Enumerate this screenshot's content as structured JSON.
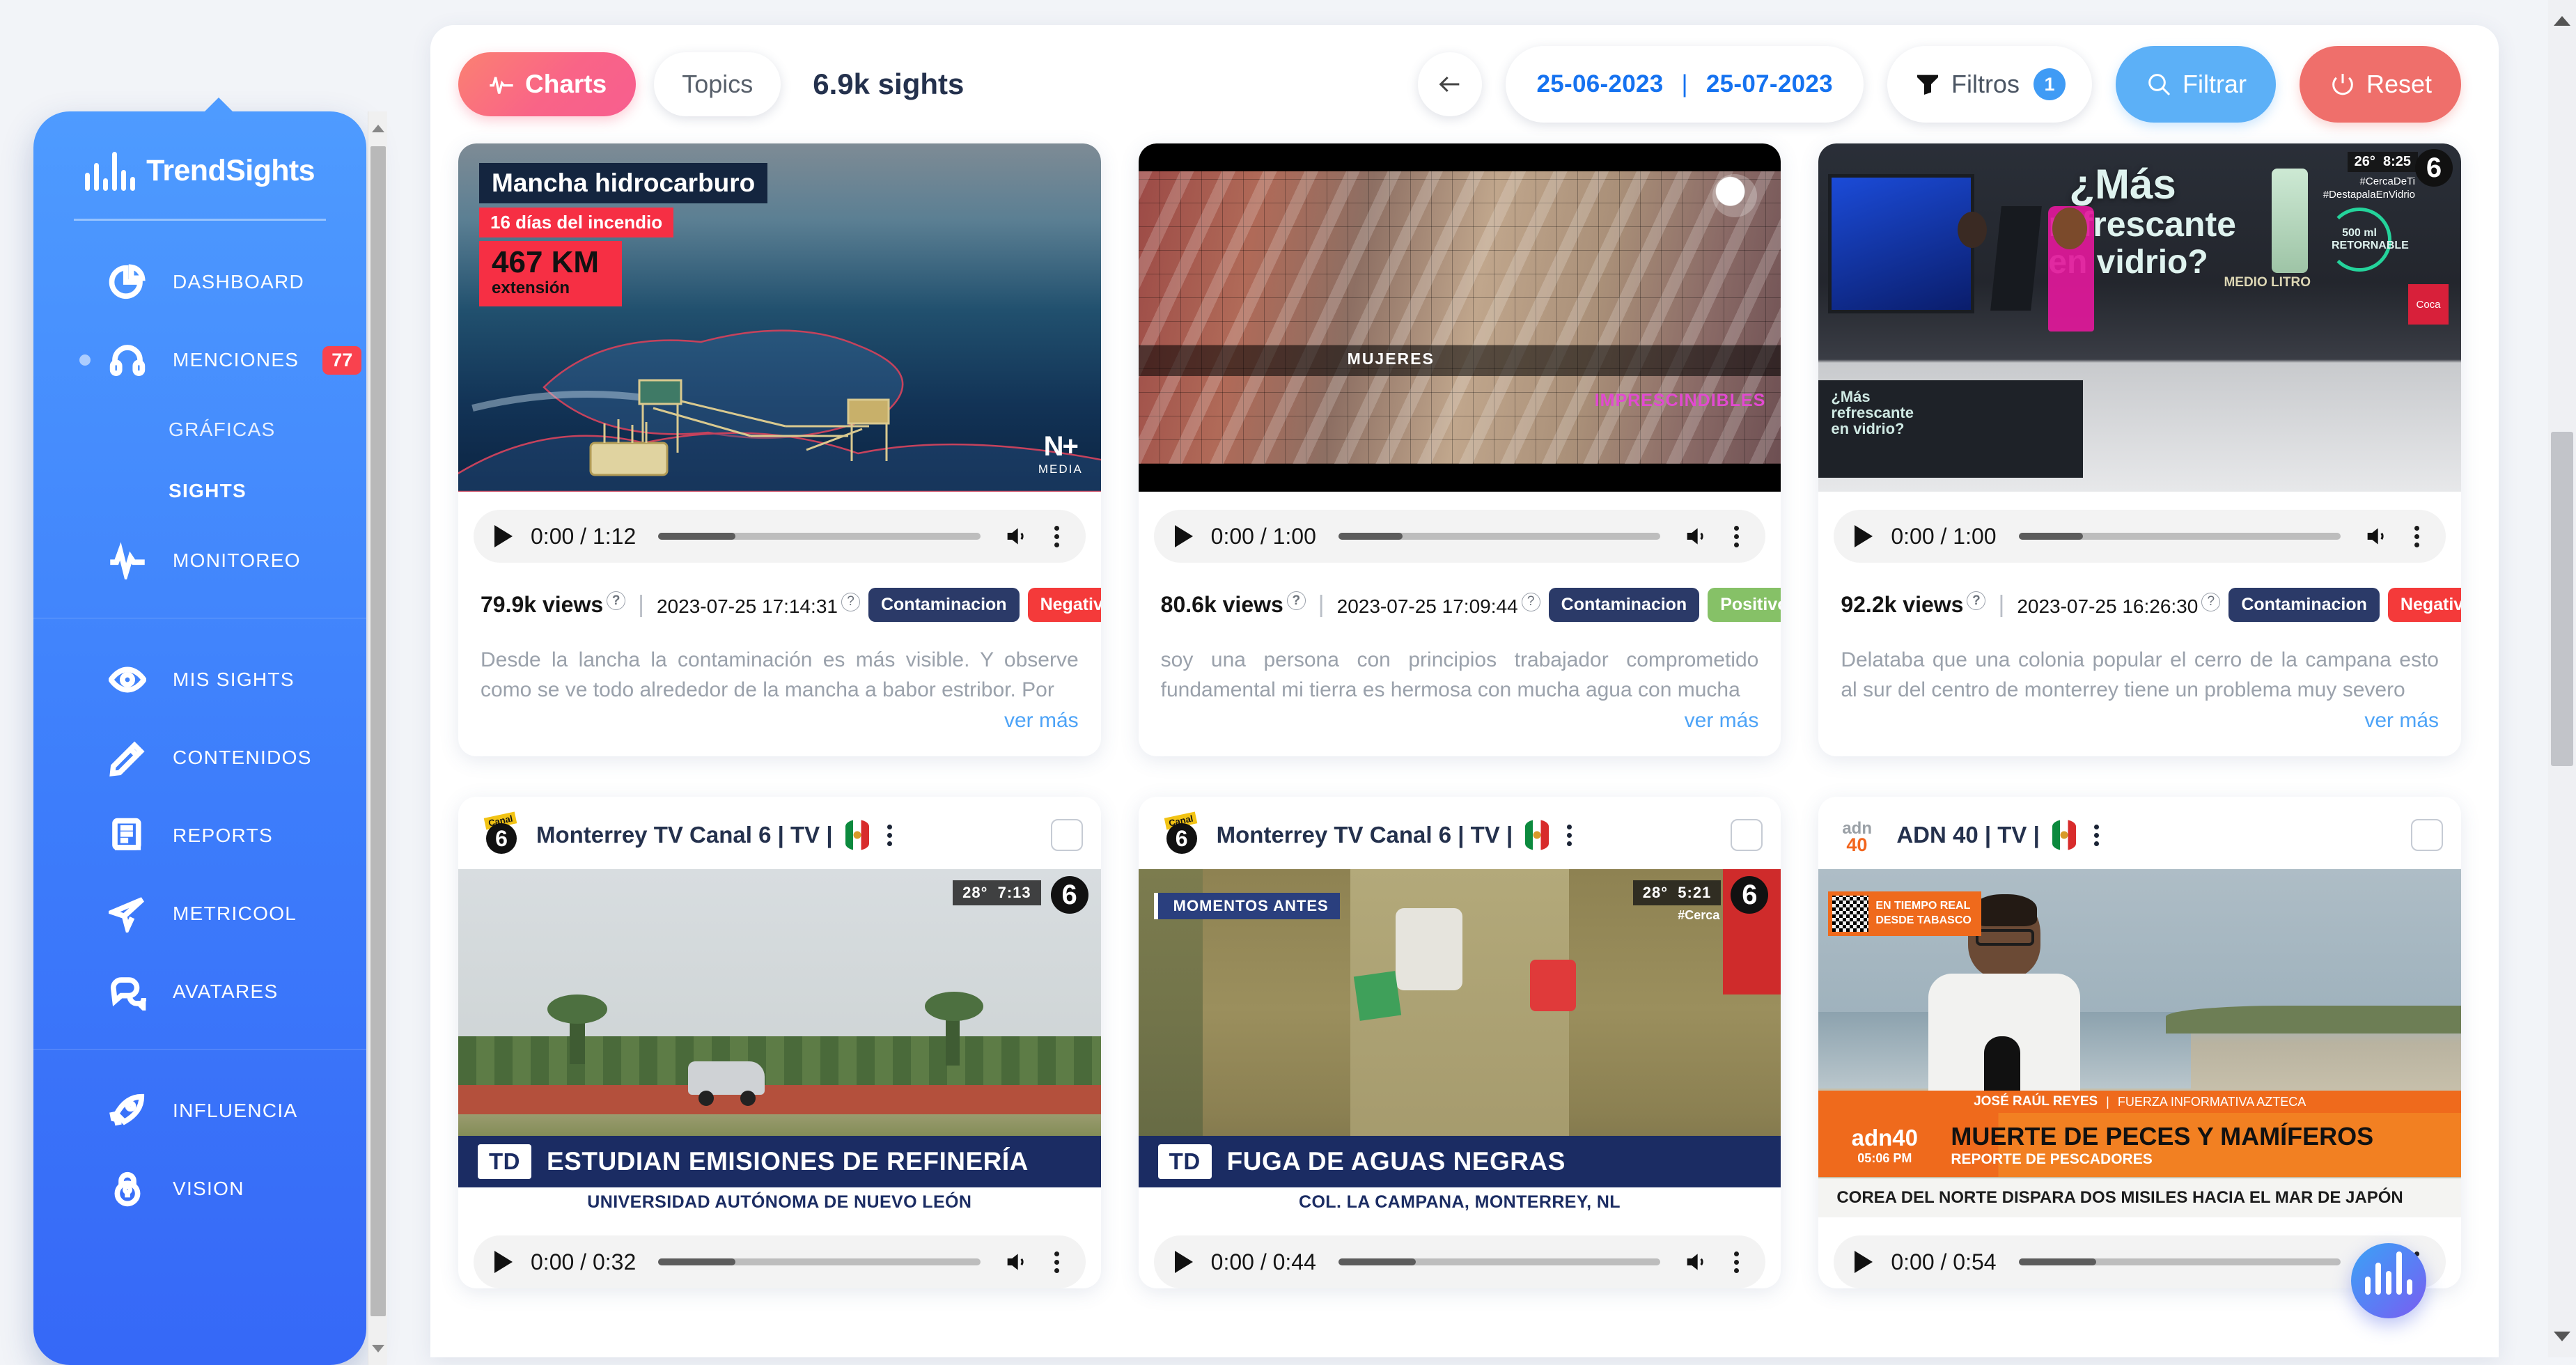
{
  "brand": {
    "name": "TrendSights"
  },
  "sidebar": {
    "groups": [
      {
        "items": [
          {
            "label": "DASHBOARD",
            "icon": "pie-chart-icon",
            "dot": "none",
            "badge": null,
            "caret": false
          },
          {
            "label": "MENCIONES",
            "icon": "headset-icon",
            "dot": "soft",
            "badge": "77",
            "caret": true
          }
        ]
      },
      {
        "sub_items": [
          {
            "label": "GRÁFICAS",
            "dot": "none"
          },
          {
            "label": "SIGHTS",
            "dot": "solid"
          }
        ]
      },
      {
        "items": [
          {
            "label": "MONITOREO",
            "icon": "pulse-icon",
            "dot": "none",
            "badge": null,
            "caret": false
          }
        ]
      },
      {
        "items": [
          {
            "label": "MIS SIGHTS",
            "icon": "eye-icon",
            "dot": "none",
            "badge": null,
            "caret": false
          },
          {
            "label": "CONTENIDOS",
            "icon": "pencil-icon",
            "dot": "none",
            "badge": null,
            "caret": false
          },
          {
            "label": "REPORTS",
            "icon": "document-icon",
            "dot": "none",
            "badge": null,
            "caret": false
          },
          {
            "label": "METRICOOL",
            "icon": "paper-plane-icon",
            "dot": "none",
            "badge": null,
            "caret": false
          },
          {
            "label": "AVATARES",
            "icon": "chat-bubbles-icon",
            "dot": "none",
            "badge": null,
            "caret": false
          }
        ]
      },
      {
        "items": [
          {
            "label": "INFLUENCIA",
            "icon": "rocket-icon",
            "dot": "none",
            "badge": null,
            "caret": false
          },
          {
            "label": "VISION",
            "icon": "lock-icon",
            "dot": "none",
            "badge": null,
            "caret": false
          }
        ]
      }
    ]
  },
  "toolbar": {
    "charts_label": "Charts",
    "topics_label": "Topics",
    "sights_count": "6.9k sights",
    "back_icon": "arrow-left-icon",
    "date_from": "25-06-2023",
    "date_sep": "|",
    "date_to": "25-07-2023",
    "filtros_label": "Filtros",
    "filtros_badge": "1",
    "filtrar_label": "Filtrar",
    "reset_label": "Reset",
    "colors": {
      "charts_accent": "#f96487",
      "date_text": "#1572f0",
      "filtrar_bg": "#5cb0f7",
      "reset_bg": "#ef6f6b",
      "badge_blue": "#3f9bf5"
    }
  },
  "cards": [
    {
      "id": "card-1",
      "has_header": false,
      "channel": null,
      "thumb": {
        "kind": "oil-spill",
        "headline": "Mancha hidrocarburo",
        "sub1": "16 días del incendio",
        "big": "467 KM",
        "sub2": "extensión",
        "watermark": "MEDIA"
      },
      "player": {
        "current": "0:00",
        "duration": "1:12",
        "progress_pct": 24
      },
      "views": "79.9k views",
      "timestamp": "2023-07-25 17:14:31",
      "tags": [
        {
          "label": "Contaminacion",
          "kind": "topic"
        },
        {
          "label": "Negativo",
          "kind": "neg"
        }
      ],
      "snippet": "Desde la lancha la contaminación es más visible. Y observe como se ve todo alrededor de la mancha a babor estribor. Por",
      "more_label": "ver más"
    },
    {
      "id": "card-2",
      "has_header": false,
      "channel": null,
      "thumb": {
        "kind": "mosaic",
        "caption1": "MUJERES",
        "caption2": "IMPRESCINDIBLES"
      },
      "player": {
        "current": "0:00",
        "duration": "1:00",
        "progress_pct": 20
      },
      "views": "80.6k views",
      "timestamp": "2023-07-25 17:09:44",
      "tags": [
        {
          "label": "Contaminacion",
          "kind": "topic"
        },
        {
          "label": "Positivo",
          "kind": "pos"
        }
      ],
      "snippet": "soy una persona con principios trabajador comprometido fundamental mi tierra es hermosa con mucha agua con mucha",
      "more_label": "ver más"
    },
    {
      "id": "card-3",
      "has_header": false,
      "channel": null,
      "thumb": {
        "kind": "studio",
        "line1": "¿Más",
        "line2": "refrescante",
        "line3": "en vidrio?",
        "temp": "26°",
        "clock": "8:25",
        "hash1": "#CercaDeTi",
        "hash2": "#DestapalaEnVidrio",
        "badge": "500 ml RETORNABLE",
        "side": "MEDIO LITRO"
      },
      "player": {
        "current": "0:00",
        "duration": "1:00",
        "progress_pct": 20
      },
      "views": "92.2k views",
      "timestamp": "2023-07-25 16:26:30",
      "tags": [
        {
          "label": "Contaminacion",
          "kind": "topic"
        },
        {
          "label": "Negativo",
          "kind": "neg"
        }
      ],
      "snippet": "Delataba que una colonia popular el cerro de la campana esto al sur del centro de monterrey tiene un problema muy severo",
      "more_label": "ver más"
    },
    {
      "id": "card-4",
      "has_header": true,
      "channel": {
        "name": "Monterrey TV Canal 6 | TV |",
        "logo": "canal6-logo",
        "flag": "mexico-flag-icon"
      },
      "thumb": {
        "kind": "refinery",
        "l3_brand": "TD",
        "l3_main": "ESTUDIAN EMISIONES DE REFINERÍA",
        "l3_sub": "UNIVERSIDAD AUTÓNOMA DE NUEVO LEÓN",
        "temp": "28°",
        "clock": "7:13",
        "net": "6"
      },
      "player": {
        "current": "0:00",
        "duration": "0:32",
        "progress_pct": 24
      },
      "views": null,
      "timestamp": null,
      "tags": [],
      "snippet": null,
      "more_label": null
    },
    {
      "id": "card-5",
      "has_header": true,
      "channel": {
        "name": "Monterrey TV Canal 6 | TV |",
        "logo": "canal6-logo",
        "flag": "mexico-flag-icon"
      },
      "thumb": {
        "kind": "sewage",
        "tag": "MOMENTOS ANTES",
        "l3_brand": "TD",
        "l3_main": "FUGA DE AGUAS NEGRAS",
        "l3_sub": "COL. LA CAMPANA, MONTERREY, NL",
        "temp": "28°",
        "clock": "5:21",
        "hash": "#Cerca",
        "net": "6"
      },
      "player": {
        "current": "0:00",
        "duration": "0:44",
        "progress_pct": 24
      },
      "views": null,
      "timestamp": null,
      "tags": [],
      "snippet": null,
      "more_label": null
    },
    {
      "id": "card-6",
      "has_header": true,
      "channel": {
        "name": "ADN 40 | TV |",
        "logo": "adn40-logo",
        "flag": "mexico-flag-icon"
      },
      "thumb": {
        "kind": "beach-reporter",
        "qr_line1": "EN TIEMPO REAL",
        "qr_line2": "DESDE TABASCO",
        "reporter": "JOSÉ RAÚL REYES",
        "reporter_org": "FUERZA INFORMATIVA AZTECA",
        "l3_brand": "adn40",
        "l3_clock": "05:06 PM",
        "l3_main": "MUERTE DE PECES Y MAMÍFEROS",
        "l3_sub": "REPORTE DE PESCADORES",
        "ticker": "COREA DEL NORTE DISPARA DOS MISILES HACIA EL MAR DE JAPÓN"
      },
      "player": {
        "current": "0:00",
        "duration": "0:54",
        "progress_pct": 24
      },
      "views": null,
      "timestamp": null,
      "tags": [],
      "snippet": null,
      "more_label": null
    }
  ],
  "fab": {
    "icon": "waveform-icon"
  }
}
